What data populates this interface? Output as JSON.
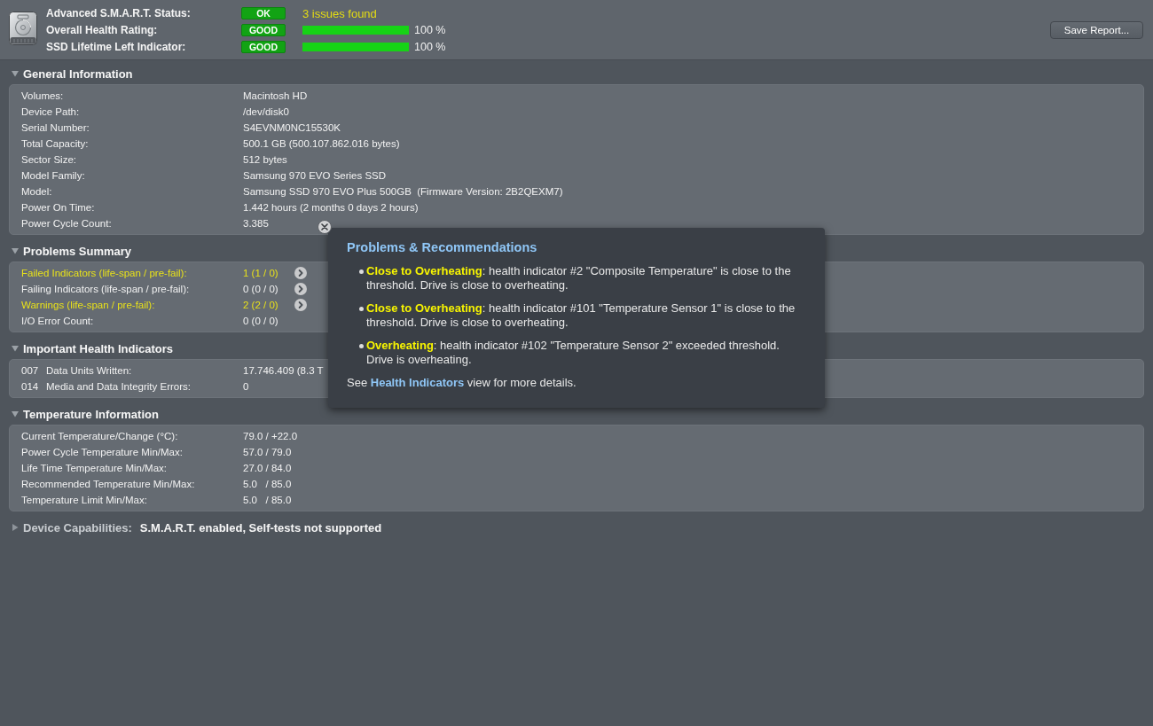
{
  "header": {
    "status_rows": [
      {
        "label": "Advanced S.M.A.R.T. Status:",
        "badge": "OK",
        "kind": "note",
        "note": "3 issues found"
      },
      {
        "label": "Overall Health Rating:",
        "badge": "GOOD",
        "kind": "bar",
        "level": 1,
        "reading": "100 %"
      },
      {
        "label": "SSD Lifetime Left Indicator:",
        "badge": "GOOD",
        "kind": "bar",
        "level": 1,
        "reading": "100 %"
      }
    ],
    "save_button": "Save Report..."
  },
  "sections": [
    {
      "title": "General Information",
      "expanded": true,
      "rows": [
        {
          "label": "Volumes:",
          "value": "Macintosh HD"
        },
        {
          "label": "Device Path:",
          "value": "/dev/disk0"
        },
        {
          "label": "Serial Number:",
          "value": "S4EVNM0NC15530K"
        },
        {
          "label": "Total Capacity:",
          "value": "500.1 GB (500.107.862.016 bytes)"
        },
        {
          "label": "Sector Size:",
          "value": "512 bytes"
        },
        {
          "label": "Model Family:",
          "value": "Samsung 970 EVO Series SSD"
        },
        {
          "label": "Model:",
          "value": "Samsung SSD 970 EVO Plus 500GB  (Firmware Version: 2B2QEXM7)"
        },
        {
          "label": "Power On Time:",
          "value": "1.442 hours (2 months 0 days 2 hours)"
        },
        {
          "label": "Power Cycle Count:",
          "value": "3.385"
        }
      ]
    },
    {
      "title": "Problems Summary",
      "expanded": true,
      "rows": [
        {
          "label": "Failed Indicators (life-span / pre-fail):",
          "value": "1 (1 / 0)",
          "warning": true,
          "details_button": true
        },
        {
          "label": "Failing Indicators (life-span / pre-fail):",
          "value": "0 (0 / 0)",
          "warning": false,
          "details_button": true
        },
        {
          "label": "Warnings (life-span / pre-fail):",
          "value": "2 (2 / 0)",
          "warning": true,
          "details_button": true
        },
        {
          "label": "I/O Error Count:",
          "value": "0 (0 / 0)",
          "warning": false,
          "details_button": false
        }
      ]
    },
    {
      "title": "Important Health Indicators",
      "expanded": true,
      "rows": [
        {
          "id": "007",
          "label": "Data Units Written:",
          "value": "17.746.409 (8.3 T"
        },
        {
          "id": "014",
          "label": "Media and Data Integrity Errors:",
          "value": "0"
        }
      ]
    },
    {
      "title": "Temperature Information",
      "expanded": true,
      "rows": [
        {
          "label": "Current Temperature/Change (°C):",
          "value": "79.0 / +22.0"
        },
        {
          "label": "Power Cycle Temperature Min/Max:",
          "value": "57.0 / 79.0"
        },
        {
          "label": "Life Time Temperature Min/Max:",
          "value": "27.0 / 84.0"
        },
        {
          "label": "Recommended Temperature Min/Max:",
          "value": "5.0   / 85.0"
        },
        {
          "label": "Temperature Limit Min/Max:",
          "value": "5.0   / 85.0"
        }
      ]
    },
    {
      "title": "Device Capabilities:",
      "expanded": false,
      "summary": "S.M.A.R.T. enabled, Self-tests not supported"
    }
  ],
  "popup": {
    "title": "Problems & Recommendations",
    "items": [
      "**Close to Overheating**: health indicator #2 \"Composite Temperature\" is close to the threshold. Drive is close to overheating.",
      "**Close to Overheating**: health indicator #101 \"Temperature Sensor 1\" is close to the threshold. Drive is close to overheating.",
      "**Overheating**: health indicator #102 \"Temperature Sensor 2\" exceeded threshold. Drive is overheating."
    ],
    "footer": {
      "before": "See",
      "link": "Health Indicators",
      "after": "view for more details."
    }
  }
}
